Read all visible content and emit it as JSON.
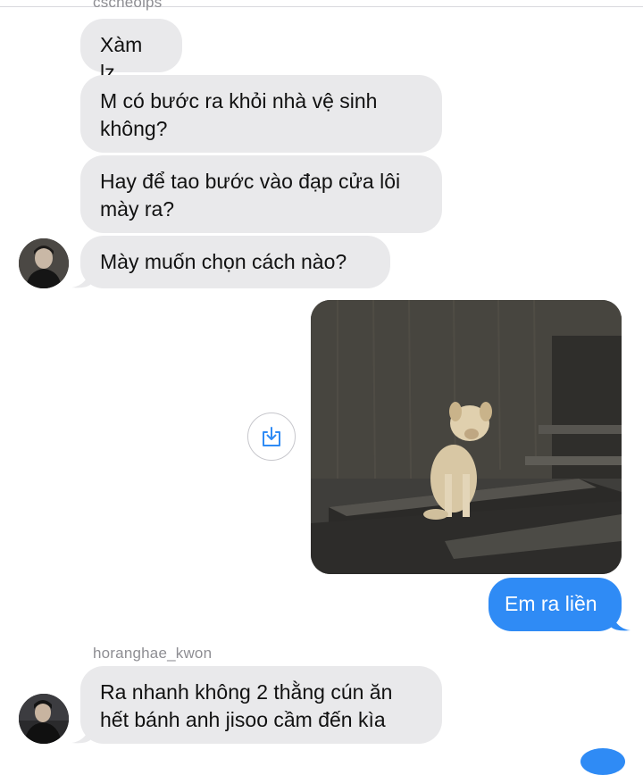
{
  "top_sender_partial": "cscheoips",
  "messages_top": [
    {
      "text": "Xàm lz"
    },
    {
      "text": "M có bước ra khỏi nhà vệ sinh không?"
    },
    {
      "text": "Hay để tao bước vào đạp cửa lôi mày ra?"
    },
    {
      "text": "Mày muốn chọn cách nào?"
    }
  ],
  "outgoing": {
    "text": "Em ra liền"
  },
  "second_sender": "horanghae_kwon",
  "messages_bottom": [
    {
      "text": "Ra nhanh không 2 thằng cún ăn hết bánh anh jisoo cầm đến kìa"
    }
  ],
  "colors": {
    "incoming_bubble": "#e9e9eb",
    "outgoing_bubble": "#2f8bf5"
  },
  "icons": {
    "save": "download-icon"
  }
}
